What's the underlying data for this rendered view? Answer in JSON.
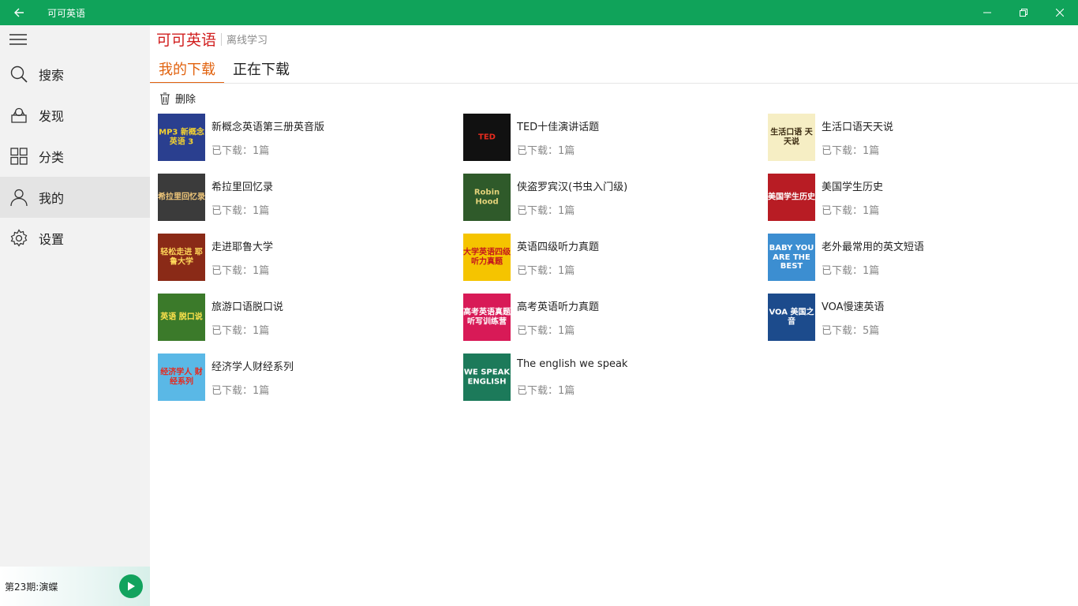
{
  "window": {
    "title": "可可英语"
  },
  "sidebar": {
    "items": [
      {
        "label": "搜索",
        "icon": "search-icon"
      },
      {
        "label": "发现",
        "icon": "discover-icon"
      },
      {
        "label": "分类",
        "icon": "category-icon"
      },
      {
        "label": "我的",
        "icon": "user-icon",
        "active": true
      },
      {
        "label": "设置",
        "icon": "gear-icon"
      }
    ],
    "player": {
      "now_playing": "第23期:演蝶"
    }
  },
  "header": {
    "brand": "可可英语",
    "subtitle": "离线学习"
  },
  "tabs": [
    {
      "label": "我的下载",
      "active": true
    },
    {
      "label": "正在下载"
    }
  ],
  "toolbar": {
    "delete_label": "删除"
  },
  "downloads": [
    {
      "title": "新概念英语第三册英音版",
      "count": "已下载：1篇",
      "cover_text": "MP3 新概念英语 3",
      "cover_bg": "#2a3f8f",
      "cover_fg": "#f3d130"
    },
    {
      "title": "TED十佳演讲话题",
      "count": "已下载：1篇",
      "cover_text": "TED",
      "cover_bg": "#111111",
      "cover_fg": "#e62b1e"
    },
    {
      "title": "生活口语天天说",
      "count": "已下载：1篇",
      "cover_text": "生活口语 天天说",
      "cover_bg": "#f6eec4",
      "cover_fg": "#3a2a10"
    },
    {
      "title": "希拉里回忆录",
      "count": "已下载：1篇",
      "cover_text": "希拉里回忆录",
      "cover_bg": "#3b3b3b",
      "cover_fg": "#f0c77a"
    },
    {
      "title": "侠盗罗宾汉(书虫入门级)",
      "count": "已下载：1篇",
      "cover_text": "Robin Hood",
      "cover_bg": "#2f5a2a",
      "cover_fg": "#e3d27a"
    },
    {
      "title": "美国学生历史",
      "count": "已下载：1篇",
      "cover_text": "美国学生历史",
      "cover_bg": "#b81c24",
      "cover_fg": "#ffffff"
    },
    {
      "title": "走进耶鲁大学",
      "count": "已下载：1篇",
      "cover_text": "轻松走进 耶鲁大学",
      "cover_bg": "#8a2a17",
      "cover_fg": "#ffd75a"
    },
    {
      "title": "英语四级听力真题",
      "count": "已下载：1篇",
      "cover_text": "大学英语四级 听力真题",
      "cover_bg": "#f5c400",
      "cover_fg": "#c4161c"
    },
    {
      "title": "老外最常用的英文短语",
      "count": "已下载：1篇",
      "cover_text": "BABY YOU ARE THE BEST",
      "cover_bg": "#3c8ed1",
      "cover_fg": "#ffffff"
    },
    {
      "title": "旅游口语脱口说",
      "count": "已下载：1篇",
      "cover_text": "英语 脱口说",
      "cover_bg": "#3b7a2a",
      "cover_fg": "#ffe34d"
    },
    {
      "title": "高考英语听力真题",
      "count": "已下载：1篇",
      "cover_text": "高考英语真题 听写训练营",
      "cover_bg": "#d81a57",
      "cover_fg": "#ffffff"
    },
    {
      "title": "VOA慢速英语",
      "count": "已下载：5篇",
      "cover_text": "VOA 美国之音",
      "cover_bg": "#1c4b8c",
      "cover_fg": "#ffffff"
    },
    {
      "title": "经济学人财经系列",
      "count": "已下载：1篇",
      "cover_text": "经济学人 财经系列",
      "cover_bg": "#5ab8e6",
      "cover_fg": "#e8271b"
    },
    {
      "title": "The english we speak",
      "count": "已下载：1篇",
      "cover_text": "WE SPEAK ENGLISH",
      "cover_bg": "#1c7a5a",
      "cover_fg": "#ffffff"
    }
  ],
  "colors": {
    "titlebar": "#10a35a",
    "accent": "#e1620e",
    "brand": "#d11f1f"
  }
}
